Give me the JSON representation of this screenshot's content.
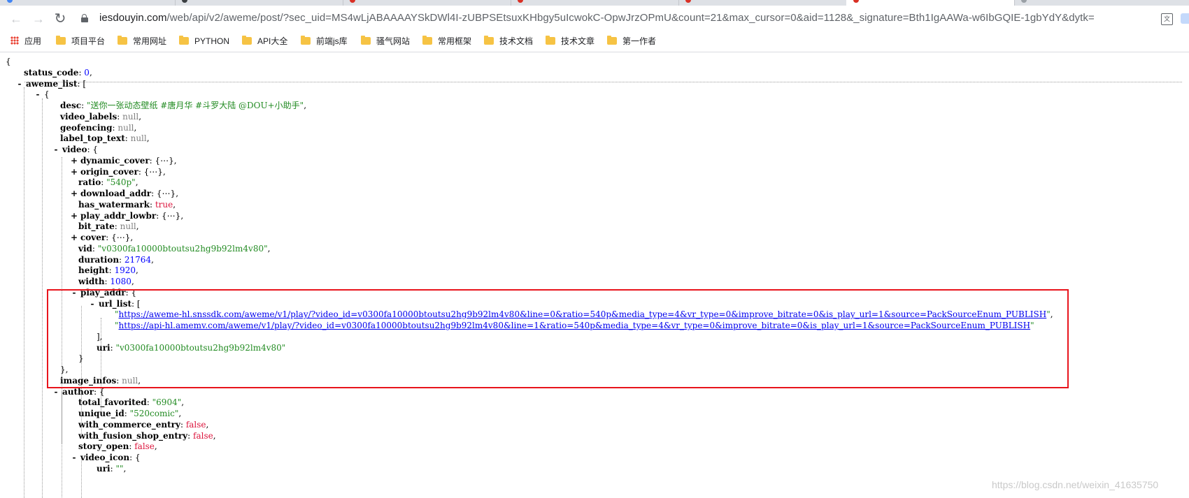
{
  "browser": {
    "url_host": "iesdouyin.com",
    "url_rest": "/web/api/v2/aweme/post/?sec_uid=MS4wLjABAAAAYSkDWl4I-zUBPSEtsuxKHbgy5uIcwokC-OpwJrzOPmU&count=21&max_cursor=0&aid=1128&_signature=Bth1IgAAWa-w6IbGQIE-1gbYdY&dytk="
  },
  "bookmarks": [
    "应用",
    "项目平台",
    "常用网址",
    "PYTHON",
    "API大全",
    "前端js库",
    "骚气网站",
    "常用框架",
    "技术文档",
    "技术文章",
    "第一作者"
  ],
  "json_lines": [
    {
      "t": "{"
    },
    {
      "k": "status_code",
      "v": "0",
      "vt": "n",
      "c": true
    },
    {
      "tg": "-",
      "k": "aweme_list",
      "o": "["
    },
    {
      "tg": "-",
      "o": "{"
    },
    {
      "k": "desc",
      "v": "\"送你一张动态壁纸 #唐月华 #斗罗大陆 @DOU+小助手\"",
      "vt": "s",
      "c": true
    },
    {
      "k": "video_labels",
      "v": "null",
      "vt": "nl",
      "c": true
    },
    {
      "k": "geofencing",
      "v": "null",
      "vt": "nl",
      "c": true
    },
    {
      "k": "label_top_text",
      "v": "null",
      "vt": "nl",
      "c": true
    },
    {
      "tg": "-",
      "k": "video",
      "o": "{"
    },
    {
      "tg": "+",
      "k": "dynamic_cover",
      "o": "{⋯},"
    },
    {
      "tg": "+",
      "k": "origin_cover",
      "o": "{⋯},"
    },
    {
      "k": "ratio",
      "v": "\"540p\"",
      "vt": "s",
      "c": true
    },
    {
      "tg": "+",
      "k": "download_addr",
      "o": "{⋯},"
    },
    {
      "k": "has_watermark",
      "v": "true",
      "vt": "b",
      "c": true
    },
    {
      "tg": "+",
      "k": "play_addr_lowbr",
      "o": "{⋯},"
    },
    {
      "k": "bit_rate",
      "v": "null",
      "vt": "nl",
      "c": true
    },
    {
      "tg": "+",
      "k": "cover",
      "o": "{⋯},"
    },
    {
      "k": "vid",
      "v": "\"v0300fa10000btoutsu2hg9b92lm4v80\"",
      "vt": "s",
      "c": true
    },
    {
      "k": "duration",
      "v": "21764",
      "vt": "n",
      "c": true
    },
    {
      "k": "height",
      "v": "1920",
      "vt": "n",
      "c": true
    },
    {
      "k": "width",
      "v": "1080",
      "vt": "n",
      "c": true
    },
    {
      "tg": "-",
      "k": "play_addr",
      "o": "{"
    },
    {
      "tg": "-",
      "k": "url_list",
      "o": "["
    },
    {
      "link": "https://aweme-hl.snssdk.com/aweme/v1/play/?video_id=v0300fa10000btoutsu2hg9b92lm4v80&line=0&ratio=540p&media_type=4&vr_type=0&improve_bitrate=0&is_play_url=1&source=PackSourceEnum_PUBLISH",
      "c": true
    },
    {
      "link": "https://api-hl.amemv.com/aweme/v1/play/?video_id=v0300fa10000btoutsu2hg9b92lm4v80&line=1&ratio=540p&media_type=4&vr_type=0&improve_bitrate=0&is_play_url=1&source=PackSourceEnum_PUBLISH"
    },
    {
      "t": "],"
    },
    {
      "k": "uri",
      "v": "\"v0300fa10000btoutsu2hg9b92lm4v80\"",
      "vt": "s"
    },
    {
      "t": "}"
    },
    {
      "t": "},"
    },
    {
      "k": "image_infos",
      "v": "null",
      "vt": "nl",
      "c": true
    },
    {
      "tg": "-",
      "k": "author",
      "o": "{"
    },
    {
      "k": "total_favorited",
      "v": "\"6904\"",
      "vt": "s",
      "c": true
    },
    {
      "k": "unique_id",
      "v": "\"520comic\"",
      "vt": "s",
      "c": true
    },
    {
      "k": "with_commerce_entry",
      "v": "false",
      "vt": "b",
      "c": true
    },
    {
      "k": "with_fusion_shop_entry",
      "v": "false",
      "vt": "b",
      "c": true
    },
    {
      "k": "story_open",
      "v": "false",
      "vt": "b",
      "c": true
    },
    {
      "tg": "-",
      "k": "video_icon",
      "o": "{"
    },
    {
      "k": "uri",
      "v": "\"\"",
      "vt": "s",
      "c": true
    }
  ],
  "watermark": "https://blog.csdn.net/weixin_41635750"
}
